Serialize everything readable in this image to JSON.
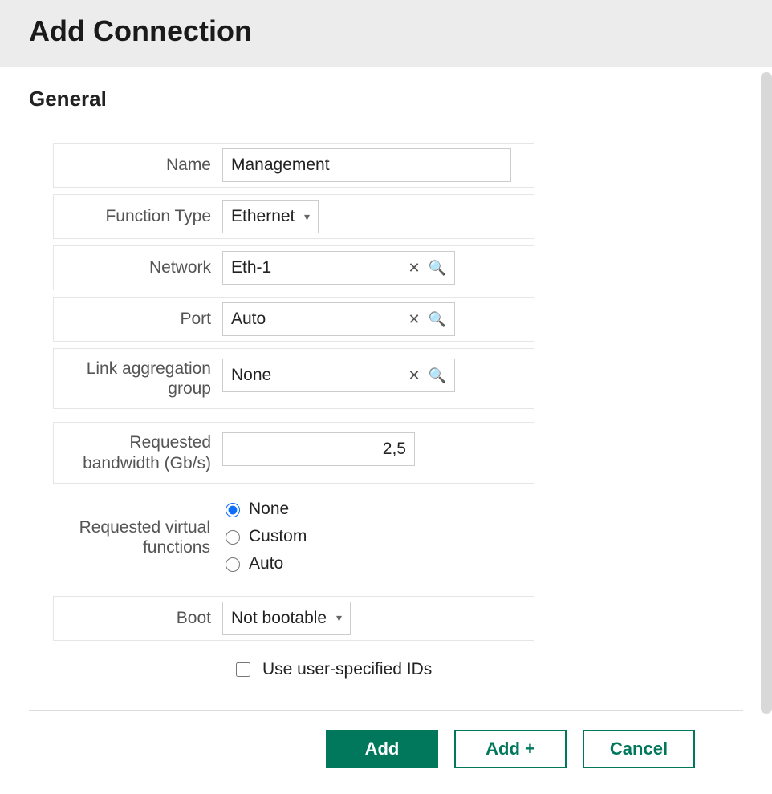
{
  "header": {
    "title": "Add Connection"
  },
  "section": {
    "title": "General"
  },
  "form": {
    "name": {
      "label": "Name",
      "value": "Management"
    },
    "function_type": {
      "label": "Function Type",
      "value": "Ethernet"
    },
    "network": {
      "label": "Network",
      "value": "Eth-1"
    },
    "port": {
      "label": "Port",
      "value": "Auto"
    },
    "lag": {
      "label": "Link aggregation group",
      "value": "None"
    },
    "bandwidth": {
      "label": "Requested bandwidth (Gb/s)",
      "value": "2,5"
    },
    "rvf": {
      "label": "Requested virtual functions",
      "options": {
        "none": "None",
        "custom": "Custom",
        "auto": "Auto"
      },
      "selected": "none"
    },
    "boot": {
      "label": "Boot",
      "value": "Not bootable"
    },
    "use_ids": {
      "label": "Use user-specified IDs",
      "checked": false
    }
  },
  "buttons": {
    "add": "Add",
    "add_plus": "Add +",
    "cancel": "Cancel"
  }
}
